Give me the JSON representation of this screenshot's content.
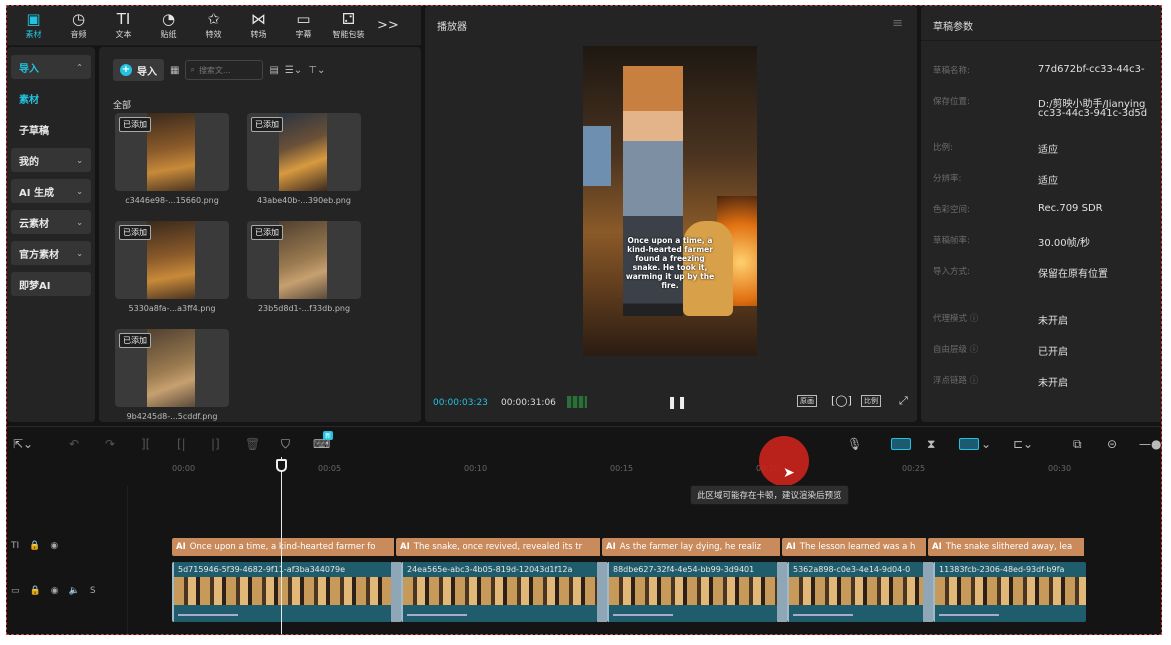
{
  "toolbar": {
    "tabs": [
      {
        "label": "素材",
        "icon": "media-icon",
        "active": true
      },
      {
        "label": "音频",
        "icon": "audio-icon"
      },
      {
        "label": "文本",
        "icon": "text-icon"
      },
      {
        "label": "贴纸",
        "icon": "sticker-icon"
      },
      {
        "label": "特效",
        "icon": "effect-icon"
      },
      {
        "label": "转场",
        "icon": "transition-icon"
      },
      {
        "label": "字幕",
        "icon": "subtitle-icon"
      },
      {
        "label": "智能包装",
        "icon": "smart-pack-icon"
      }
    ],
    "more": ">>"
  },
  "nav": {
    "items": [
      {
        "label": "导入"
      },
      {
        "label": "素材"
      },
      {
        "label": "子草稿"
      },
      {
        "label": "我的"
      },
      {
        "label": "AI 生成"
      },
      {
        "label": "云素材"
      },
      {
        "label": "官方素材"
      },
      {
        "label": "即梦AI"
      }
    ]
  },
  "media": {
    "import_label": "导入",
    "search_placeholder": "搜索文...",
    "all_label": "全部",
    "badge": "已添加",
    "files": [
      "c3446e98-...15660.png",
      "43abe40b-...390eb.png",
      "5330a8fa-...a3ff4.png",
      "23b5d8d1-...f33db.png",
      "9b4245d8-...5cddf.png"
    ]
  },
  "player": {
    "title": "播放器",
    "caption": "Once upon a time, a kind-hearted farmer found a freezing snake. He took it, warming it up by the fire.",
    "current": "00:00:03:23",
    "total": "00:00:31:06",
    "btn_original": "原画",
    "btn_ratio": "比例"
  },
  "props": {
    "title": "草稿参数",
    "rows": [
      {
        "k": "草稿名称:",
        "v": "77d672bf-cc33-44c3-"
      },
      {
        "k": "保存位置:",
        "v": "D:/剪映小助手/Jianying",
        "v2": "cc33-44c3-941c-3d5d"
      },
      {
        "k": "比例:",
        "v": "适应"
      },
      {
        "k": "分辨率:",
        "v": "适应"
      },
      {
        "k": "色彩空间:",
        "v": "Rec.709 SDR"
      },
      {
        "k": "草稿帧率:",
        "v": "30.00帧/秒"
      },
      {
        "k": "导入方式:",
        "v": "保留在原有位置"
      },
      {
        "k": "代理模式 ⓘ",
        "v": "未开启"
      },
      {
        "k": "自由层级 ⓘ",
        "v": "已开启"
      },
      {
        "k": "浮点链路 ⓘ",
        "v": "未开启"
      }
    ]
  },
  "timeline": {
    "ruler": [
      "00:00",
      "00:05",
      "00:10",
      "00:15",
      "00:20",
      "00:25",
      "00:30"
    ],
    "tooltip": "此区域可能存在卡顿，建议渲染后预览",
    "new_badge": "新",
    "subtitles": [
      "Once upon a time, a kind-hearted farmer fo",
      "The snake, once revived, revealed its tr",
      "As the farmer lay dying, he realiz",
      "The lesson learned was a h",
      "The snake slithered away, lea"
    ],
    "videos": [
      "5d715946-5f39-4682-9f11-af3ba344079e",
      "24ea565e-abc3-4b05-819d-12043d1f12a",
      "88dbe627-32f4-4e54-bb99-3d9401",
      "5362a898-c0e3-4e14-9d04-0",
      "11383fcb-2306-48ed-93df-b9fa"
    ],
    "ai_tag": "AI"
  }
}
